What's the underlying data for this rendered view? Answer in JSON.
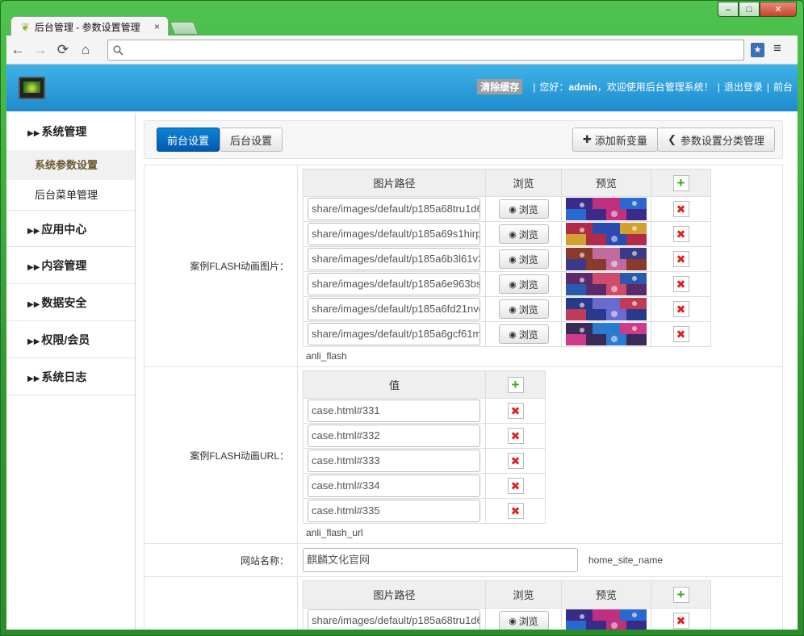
{
  "browser": {
    "tab_title": "后台管理 - 参数设置管理",
    "tab_close": "×",
    "window_buttons": {
      "minimize": "‒",
      "maximize": "□",
      "close": "✕"
    },
    "nav": {
      "back": "←",
      "forward": "→",
      "reload": "⟳",
      "home": "⌂"
    },
    "address_value": "",
    "menu_icon": "≡"
  },
  "header": {
    "clear_cache": "清除缓存",
    "greeting_prefix": "您好：",
    "user": "admin",
    "greeting_suffix": "，欢迎使用后台管理系统！",
    "logout": "退出登录",
    "frontend": "前台",
    "separator": "|"
  },
  "sidebar": {
    "groups": [
      {
        "label": "系统管理",
        "items": [
          "系统参数设置",
          "后台菜单管理"
        ]
      },
      {
        "label": "应用中心"
      },
      {
        "label": "内容管理"
      },
      {
        "label": "数据安全"
      },
      {
        "label": "权限/会员"
      },
      {
        "label": "系统日志"
      }
    ]
  },
  "toolbar": {
    "tab_front": "前台设置",
    "tab_back": "后台设置",
    "add_variable": "添加新变量",
    "category_manage": "参数设置分类管理",
    "add_icon": "✚",
    "back_icon": "❮"
  },
  "image_table_headers": {
    "path": "图片路径",
    "browse": "浏览",
    "preview": "预览"
  },
  "browse_label": "浏览",
  "eye_icon": "👁",
  "value_header": "值",
  "rows": {
    "anli_flash": {
      "label": "案例FLASH动画图片：",
      "key": "anli_flash",
      "paths": [
        "share/images/default/p185a68tru1d6",
        "share/images/default/p185a69s1hirp",
        "share/images/default/p185a6b3l61v3",
        "share/images/default/p185a6e963bs",
        "share/images/default/p185a6fd21nvc",
        "share/images/default/p185a6gcf61m"
      ]
    },
    "anli_flash_url": {
      "label": "案例FLASH动画URL：",
      "key": "anli_flash_url",
      "values": [
        "case.html#331",
        "case.html#332",
        "case.html#333",
        "case.html#334",
        "case.html#335"
      ]
    },
    "site_name": {
      "label": "网站名称：",
      "value": "麒麟文化官网",
      "key": "home_site_name"
    },
    "last_images": {
      "paths": [
        "share/images/default/p185a68tru1d6"
      ]
    }
  },
  "colors": {
    "header_blue": "#1f8bcd",
    "primary_button": "#0558b0",
    "window_green": "#2f9a2f"
  }
}
